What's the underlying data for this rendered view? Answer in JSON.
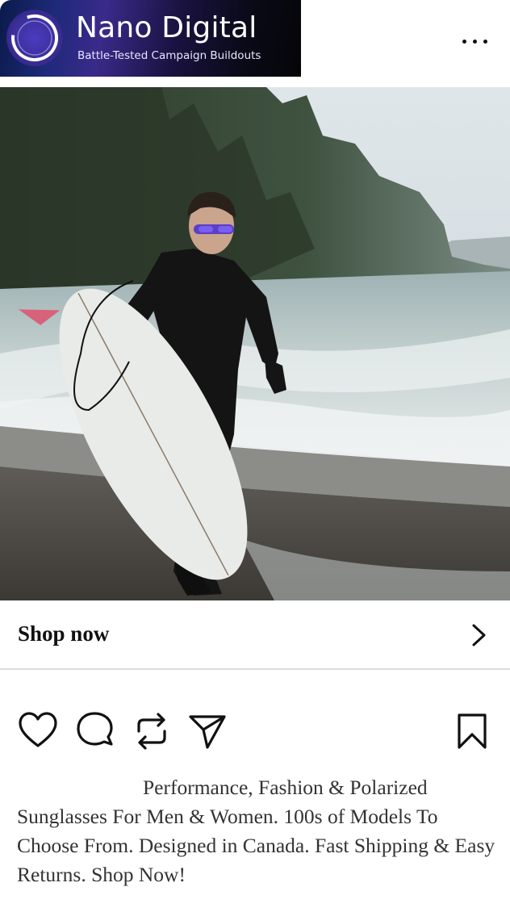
{
  "header": {
    "brand_name": "Nano Digital",
    "brand_tagline": "Battle-Tested Campaign Buildouts",
    "menu_icon": "more-horizontal-icon"
  },
  "post": {
    "image_alt": "",
    "cta_label": "Shop now",
    "cta_icon": "chevron-right-icon"
  },
  "actions": {
    "icons": [
      "heart-icon",
      "comment-icon",
      "repost-icon",
      "send-icon",
      "bookmark-icon"
    ]
  },
  "caption": {
    "text": "Performance, Fashion & Polarized Sunglasses For Men & Women. 100s of Models To Choose From. Designed in Canada. Fast Shipping & Easy Returns. Shop Now!"
  },
  "colors": {
    "brand_gradient_start": "#1d2a7a",
    "brand_gradient_end": "#050508",
    "icon_stroke": "#111111",
    "divider": "#dcdcdc"
  }
}
